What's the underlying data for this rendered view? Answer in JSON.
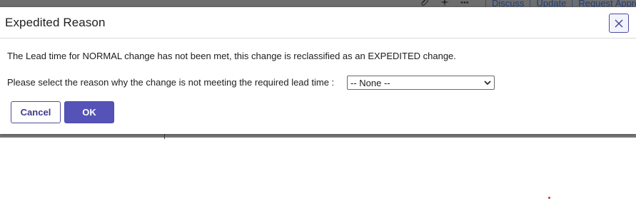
{
  "background": {
    "actions": [
      {
        "type": "icon",
        "name": "paperclip-icon",
        "glyph": "⌇"
      },
      {
        "type": "icon",
        "name": "sparkle-icon",
        "glyph": "✦"
      },
      {
        "type": "icon",
        "name": "more-options-icon",
        "glyph": "•••"
      },
      {
        "type": "link",
        "label": "Discuss"
      },
      {
        "type": "link",
        "label": "Update"
      },
      {
        "type": "link",
        "label": "Request Approval"
      }
    ]
  },
  "modal": {
    "title": "Expedited Reason",
    "close_icon": "close-icon",
    "message": "The Lead time for NORMAL change has not been met, this change is reclassified as an EXPEDITED change.",
    "prompt": "Please select the reason why the change is not meeting the required lead time :",
    "reason_select": {
      "selected": "-- None --"
    },
    "buttons": {
      "cancel_label": "Cancel",
      "ok_label": "OK"
    }
  },
  "colors": {
    "accent": "#5553b7",
    "accent_border": "#4f4d9e",
    "link": "#1f3f7a"
  }
}
